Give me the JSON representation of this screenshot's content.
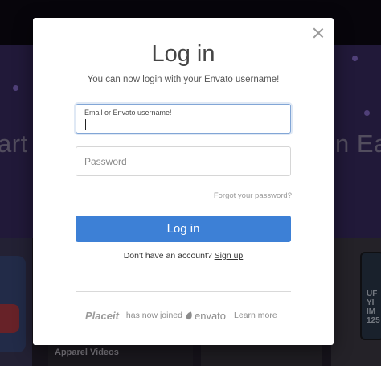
{
  "background": {
    "hero_left_text": "art",
    "hero_right_text": "n Ea",
    "card_caption": "Apparel Videos",
    "phone_text": "UF\nYI\nIM\n125"
  },
  "modal": {
    "title": "Log in",
    "subtitle": "You can now login with your Envato username!",
    "email_label": "Email or Envato username!",
    "email_value": "",
    "password_placeholder": "Password",
    "password_value": "",
    "forgot_password": "Forgot your password?",
    "login_button": "Log in",
    "no_account_text": "Don't have an account?",
    "signup_link": "Sign up",
    "close_icon": "close-icon"
  },
  "footer": {
    "placeit_logo": "Placeit",
    "joined_text": "has now joined",
    "envato_logo": "envato",
    "learn_more": "Learn more"
  },
  "colors": {
    "accent": "#3d80d6",
    "focus_border": "#82a6d6",
    "overlay": "rgba(0,0,0,0.42)"
  }
}
